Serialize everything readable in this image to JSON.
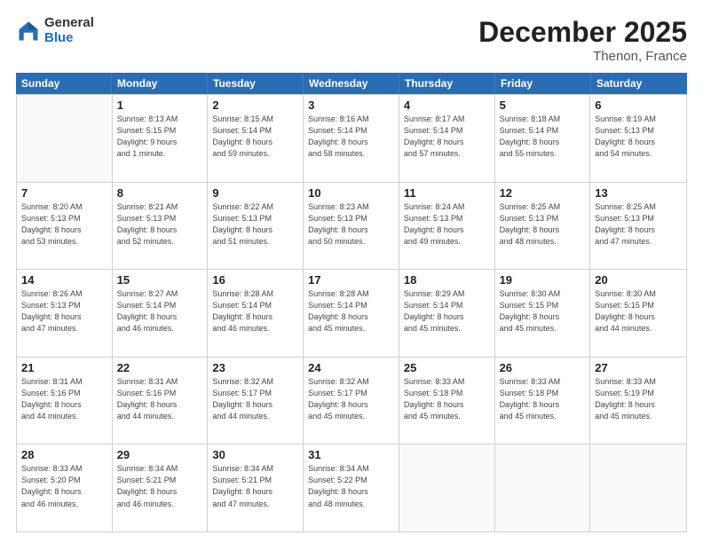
{
  "logo": {
    "general": "General",
    "blue": "Blue"
  },
  "header": {
    "month": "December 2025",
    "location": "Thenon, France"
  },
  "weekdays": [
    "Sunday",
    "Monday",
    "Tuesday",
    "Wednesday",
    "Thursday",
    "Friday",
    "Saturday"
  ],
  "weeks": [
    [
      {
        "day": "",
        "info": ""
      },
      {
        "day": "1",
        "info": "Sunrise: 8:13 AM\nSunset: 5:15 PM\nDaylight: 9 hours\nand 1 minute."
      },
      {
        "day": "2",
        "info": "Sunrise: 8:15 AM\nSunset: 5:14 PM\nDaylight: 8 hours\nand 59 minutes."
      },
      {
        "day": "3",
        "info": "Sunrise: 8:16 AM\nSunset: 5:14 PM\nDaylight: 8 hours\nand 58 minutes."
      },
      {
        "day": "4",
        "info": "Sunrise: 8:17 AM\nSunset: 5:14 PM\nDaylight: 8 hours\nand 57 minutes."
      },
      {
        "day": "5",
        "info": "Sunrise: 8:18 AM\nSunset: 5:14 PM\nDaylight: 8 hours\nand 55 minutes."
      },
      {
        "day": "6",
        "info": "Sunrise: 8:19 AM\nSunset: 5:13 PM\nDaylight: 8 hours\nand 54 minutes."
      }
    ],
    [
      {
        "day": "7",
        "info": "Sunrise: 8:20 AM\nSunset: 5:13 PM\nDaylight: 8 hours\nand 53 minutes."
      },
      {
        "day": "8",
        "info": "Sunrise: 8:21 AM\nSunset: 5:13 PM\nDaylight: 8 hours\nand 52 minutes."
      },
      {
        "day": "9",
        "info": "Sunrise: 8:22 AM\nSunset: 5:13 PM\nDaylight: 8 hours\nand 51 minutes."
      },
      {
        "day": "10",
        "info": "Sunrise: 8:23 AM\nSunset: 5:13 PM\nDaylight: 8 hours\nand 50 minutes."
      },
      {
        "day": "11",
        "info": "Sunrise: 8:24 AM\nSunset: 5:13 PM\nDaylight: 8 hours\nand 49 minutes."
      },
      {
        "day": "12",
        "info": "Sunrise: 8:25 AM\nSunset: 5:13 PM\nDaylight: 8 hours\nand 48 minutes."
      },
      {
        "day": "13",
        "info": "Sunrise: 8:25 AM\nSunset: 5:13 PM\nDaylight: 8 hours\nand 47 minutes."
      }
    ],
    [
      {
        "day": "14",
        "info": "Sunrise: 8:26 AM\nSunset: 5:13 PM\nDaylight: 8 hours\nand 47 minutes."
      },
      {
        "day": "15",
        "info": "Sunrise: 8:27 AM\nSunset: 5:14 PM\nDaylight: 8 hours\nand 46 minutes."
      },
      {
        "day": "16",
        "info": "Sunrise: 8:28 AM\nSunset: 5:14 PM\nDaylight: 8 hours\nand 46 minutes."
      },
      {
        "day": "17",
        "info": "Sunrise: 8:28 AM\nSunset: 5:14 PM\nDaylight: 8 hours\nand 45 minutes."
      },
      {
        "day": "18",
        "info": "Sunrise: 8:29 AM\nSunset: 5:14 PM\nDaylight: 8 hours\nand 45 minutes."
      },
      {
        "day": "19",
        "info": "Sunrise: 8:30 AM\nSunset: 5:15 PM\nDaylight: 8 hours\nand 45 minutes."
      },
      {
        "day": "20",
        "info": "Sunrise: 8:30 AM\nSunset: 5:15 PM\nDaylight: 8 hours\nand 44 minutes."
      }
    ],
    [
      {
        "day": "21",
        "info": "Sunrise: 8:31 AM\nSunset: 5:16 PM\nDaylight: 8 hours\nand 44 minutes."
      },
      {
        "day": "22",
        "info": "Sunrise: 8:31 AM\nSunset: 5:16 PM\nDaylight: 8 hours\nand 44 minutes."
      },
      {
        "day": "23",
        "info": "Sunrise: 8:32 AM\nSunset: 5:17 PM\nDaylight: 8 hours\nand 44 minutes."
      },
      {
        "day": "24",
        "info": "Sunrise: 8:32 AM\nSunset: 5:17 PM\nDaylight: 8 hours\nand 45 minutes."
      },
      {
        "day": "25",
        "info": "Sunrise: 8:33 AM\nSunset: 5:18 PM\nDaylight: 8 hours\nand 45 minutes."
      },
      {
        "day": "26",
        "info": "Sunrise: 8:33 AM\nSunset: 5:18 PM\nDaylight: 8 hours\nand 45 minutes."
      },
      {
        "day": "27",
        "info": "Sunrise: 8:33 AM\nSunset: 5:19 PM\nDaylight: 8 hours\nand 45 minutes."
      }
    ],
    [
      {
        "day": "28",
        "info": "Sunrise: 8:33 AM\nSunset: 5:20 PM\nDaylight: 8 hours\nand 46 minutes."
      },
      {
        "day": "29",
        "info": "Sunrise: 8:34 AM\nSunset: 5:21 PM\nDaylight: 8 hours\nand 46 minutes."
      },
      {
        "day": "30",
        "info": "Sunrise: 8:34 AM\nSunset: 5:21 PM\nDaylight: 8 hours\nand 47 minutes."
      },
      {
        "day": "31",
        "info": "Sunrise: 8:34 AM\nSunset: 5:22 PM\nDaylight: 8 hours\nand 48 minutes."
      },
      {
        "day": "",
        "info": ""
      },
      {
        "day": "",
        "info": ""
      },
      {
        "day": "",
        "info": ""
      }
    ]
  ]
}
